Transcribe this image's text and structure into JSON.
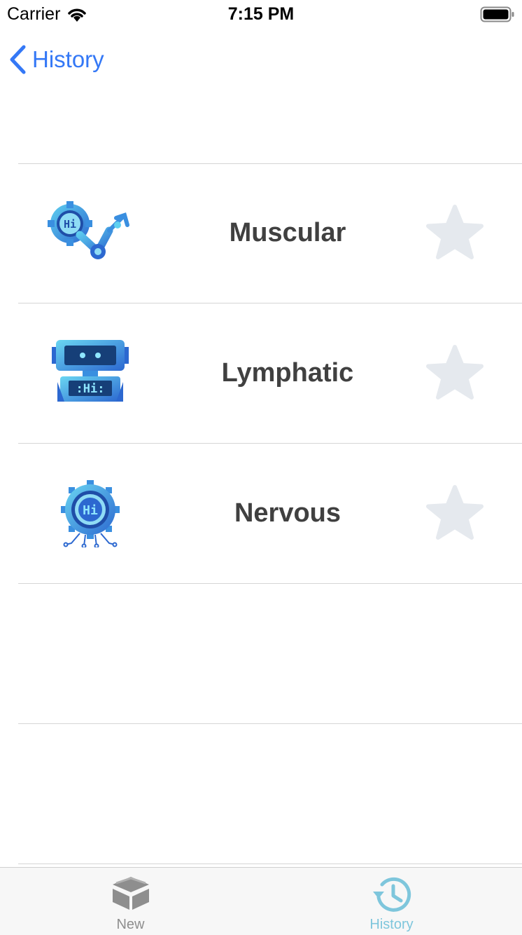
{
  "status_bar": {
    "carrier": "Carrier",
    "time": "7:15 PM"
  },
  "nav": {
    "back_label": "History"
  },
  "items": [
    {
      "title": "Muscular",
      "icon": "robot-arm-icon",
      "favorited": false
    },
    {
      "title": "Lymphatic",
      "icon": "robot-head-icon",
      "favorited": false
    },
    {
      "title": "Nervous",
      "icon": "circuit-gear-icon",
      "favorited": false
    }
  ],
  "tabbar": {
    "tabs": [
      {
        "label": "New",
        "icon": "box-icon",
        "active": false
      },
      {
        "label": "History",
        "icon": "history-clock-icon",
        "active": true
      }
    ]
  },
  "colors": {
    "accent": "#3478f6",
    "tab_active": "#7ec6dc",
    "tab_inactive": "#8e8e8e",
    "star": "#e5e9ee",
    "title": "#404040"
  }
}
